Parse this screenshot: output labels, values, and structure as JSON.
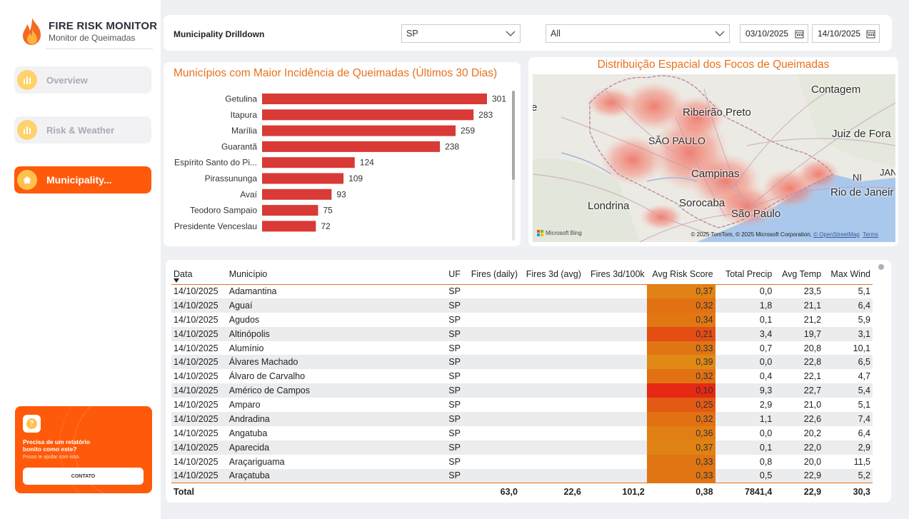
{
  "app": {
    "title": "FIRE RISK MONITOR",
    "subtitle": "Monitor  de Queimadas"
  },
  "nav": [
    {
      "label": "Overview",
      "active": false
    },
    {
      "label": "Risk & Weather",
      "active": false
    },
    {
      "label": "Municipality...",
      "active": true
    }
  ],
  "promo": {
    "title": "Precisa de um relatório bonito como este?",
    "subtitle": "Posso te ajudar com isso.",
    "button": "CONTATO"
  },
  "filters": {
    "title": "Municipality Drilldown",
    "state_value": "SP",
    "municipality_value": "All",
    "date_start": "03/10/2025",
    "date_end": "14/10/2025"
  },
  "bar_card": {
    "title": "Municípios com Maior Incidência de Queimadas (Últimos 30 Dias)"
  },
  "map_card": {
    "title": "Distribuição Espacial dos Focos de Queimadas",
    "labels": {
      "contagem": "Contagem",
      "ribeirao": "Ribeirão Preto",
      "saopaulo_state": "SÃO PAULO",
      "juiz": "Juiz de Fora",
      "campinas": "Campinas",
      "ni": "NI",
      "jan": "JAN",
      "rio": "Rio de Janeir",
      "londrina": "Londrina",
      "sorocaba": "Sorocaba",
      "saopaulo_city": "São Paulo",
      "e": "e"
    },
    "bing": "Microsoft Bing",
    "copyright": "© 2025 TomTom, © 2025 Microsoft Corporation,",
    "osm": "© OpenStreetMap",
    "terms": "Terms"
  },
  "chart_data": {
    "type": "bar",
    "orientation": "horizontal",
    "title": "Municípios com Maior Incidência de Queimadas (Últimos 30 Dias)",
    "categories": [
      "Getulina",
      "Itapura",
      "Marília",
      "Guarantã",
      "Espírito Santo do Pi...",
      "Pirassununga",
      "Avaí",
      "Teodoro Sampaio",
      "Presidente Venceslau"
    ],
    "values": [
      301,
      283,
      259,
      238,
      124,
      109,
      93,
      75,
      72
    ],
    "color": "#d93a36",
    "xlim": [
      0,
      301
    ]
  },
  "table": {
    "columns": [
      "Data",
      "Município",
      "UF",
      "Fires (daily)",
      "Fires 3d (avg)",
      "Fires 3d/100k",
      "Avg Risk Score",
      "Total Precip",
      "Avg Temp",
      "Max Wind"
    ],
    "rows": [
      [
        "14/10/2025",
        "Adamantina",
        "SP",
        "",
        "",
        "",
        "0,37",
        "0,0",
        "23,5",
        "5,1"
      ],
      [
        "14/10/2025",
        "Aguaí",
        "SP",
        "",
        "",
        "",
        "0,32",
        "1,8",
        "21,1",
        "6,4"
      ],
      [
        "14/10/2025",
        "Agudos",
        "SP",
        "",
        "",
        "",
        "0,34",
        "0,1",
        "21,2",
        "5,9"
      ],
      [
        "14/10/2025",
        "Altinópolis",
        "SP",
        "",
        "",
        "",
        "0,21",
        "3,4",
        "19,7",
        "3,1"
      ],
      [
        "14/10/2025",
        "Alumínio",
        "SP",
        "",
        "",
        "",
        "0,33",
        "0,7",
        "20,8",
        "10,1"
      ],
      [
        "14/10/2025",
        "Álvares Machado",
        "SP",
        "",
        "",
        "",
        "0,39",
        "0,0",
        "22,8",
        "6,5"
      ],
      [
        "14/10/2025",
        "Álvaro de Carvalho",
        "SP",
        "",
        "",
        "",
        "0,32",
        "0,4",
        "22,1",
        "4,7"
      ],
      [
        "14/10/2025",
        "Américo de Campos",
        "SP",
        "",
        "",
        "",
        "0,10",
        "9,3",
        "22,7",
        "5,4"
      ],
      [
        "14/10/2025",
        "Amparo",
        "SP",
        "",
        "",
        "",
        "0,25",
        "2,9",
        "21,0",
        "5,1"
      ],
      [
        "14/10/2025",
        "Andradina",
        "SP",
        "",
        "",
        "",
        "0,32",
        "1,1",
        "22,6",
        "7,4"
      ],
      [
        "14/10/2025",
        "Angatuba",
        "SP",
        "",
        "",
        "",
        "0,36",
        "0,0",
        "20,2",
        "6,4"
      ],
      [
        "14/10/2025",
        "Aparecida",
        "SP",
        "",
        "",
        "",
        "0,37",
        "0,1",
        "22,0",
        "2,9"
      ],
      [
        "14/10/2025",
        "Araçariguama",
        "SP",
        "",
        "",
        "",
        "0,33",
        "0,8",
        "20,0",
        "11,5"
      ],
      [
        "14/10/2025",
        "Araçatuba",
        "SP",
        "",
        "",
        "",
        "0,33",
        "0,5",
        "22,9",
        "5,2"
      ]
    ],
    "total": [
      "Total",
      "",
      "",
      "63,0",
      "22,6",
      "101,2",
      "0,38",
      "7841,4",
      "22,9",
      "30,3"
    ]
  }
}
